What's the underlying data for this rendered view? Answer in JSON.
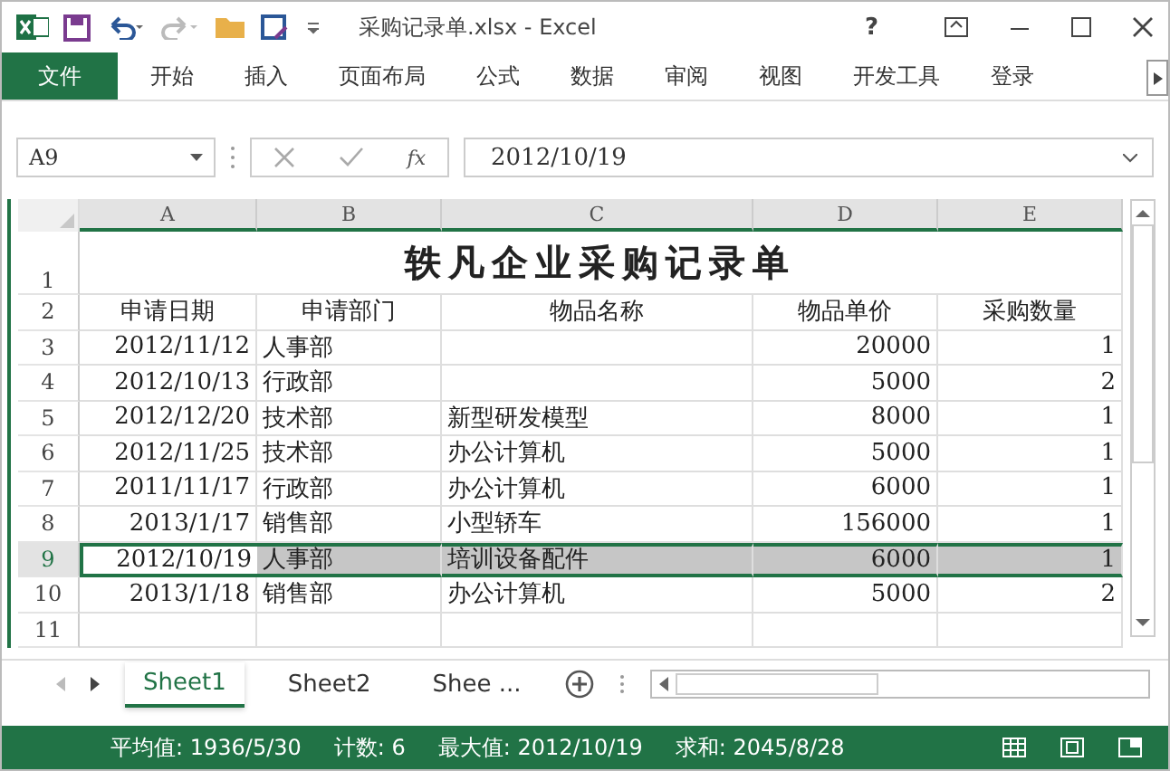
{
  "window": {
    "title": "采购记录单.xlsx - Excel",
    "help": "?"
  },
  "ribbon_tabs": [
    {
      "label": "文件",
      "kind": "file"
    },
    {
      "label": "开始",
      "kind": "tab"
    },
    {
      "label": "插入",
      "kind": "tab"
    },
    {
      "label": "页面布局",
      "kind": "tab"
    },
    {
      "label": "公式",
      "kind": "tab"
    },
    {
      "label": "数据",
      "kind": "tab"
    },
    {
      "label": "审阅",
      "kind": "tab"
    },
    {
      "label": "视图",
      "kind": "tab"
    },
    {
      "label": "开发工具",
      "kind": "tab"
    },
    {
      "label": "登录",
      "kind": "tab"
    }
  ],
  "formula_bar": {
    "name_box": "A9",
    "fx": "fx",
    "value": "2012/10/19"
  },
  "sheet": {
    "columns": [
      "A",
      "B",
      "C",
      "D",
      "E"
    ],
    "title": "轶凡企业采购记录单",
    "headers": [
      "申请日期",
      "申请部门",
      "物品名称",
      "物品单价",
      "采购数量"
    ],
    "rows": [
      {
        "cells": [
          "2012/11/12",
          "人事部",
          "",
          "20000",
          "1"
        ],
        "selected": false
      },
      {
        "cells": [
          "2012/10/13",
          "行政部",
          "",
          "5000",
          "2"
        ],
        "selected": false
      },
      {
        "cells": [
          "2012/12/20",
          "技术部",
          "新型研发模型",
          "8000",
          "1"
        ],
        "selected": false
      },
      {
        "cells": [
          "2012/11/25",
          "技术部",
          "办公计算机",
          "5000",
          "1"
        ],
        "selected": false
      },
      {
        "cells": [
          "2011/11/17",
          "行政部",
          "办公计算机",
          "6000",
          "1"
        ],
        "selected": false
      },
      {
        "cells": [
          "2013/1/17",
          "销售部",
          "小型轿车",
          "156000",
          "1"
        ],
        "selected": false
      },
      {
        "cells": [
          "2012/10/19",
          "人事部",
          "培训设备配件",
          "6000",
          "1"
        ],
        "selected": true
      },
      {
        "cells": [
          "2013/1/18",
          "销售部",
          "办公计算机",
          "5000",
          "2"
        ],
        "selected": false
      }
    ],
    "row_numbers": [
      "1",
      "2",
      "3",
      "4",
      "5",
      "6",
      "7",
      "8",
      "9",
      "10",
      "11"
    ]
  },
  "sheet_tabs": [
    {
      "label": "Sheet1",
      "selected": true
    },
    {
      "label": "Sheet2",
      "selected": false
    },
    {
      "label": "Shee ...",
      "selected": false
    }
  ],
  "status_bar": [
    "平均值: 1936/5/30",
    "计数: 6",
    "最大值: 2012/10/19",
    "求和: 2045/8/28"
  ]
}
